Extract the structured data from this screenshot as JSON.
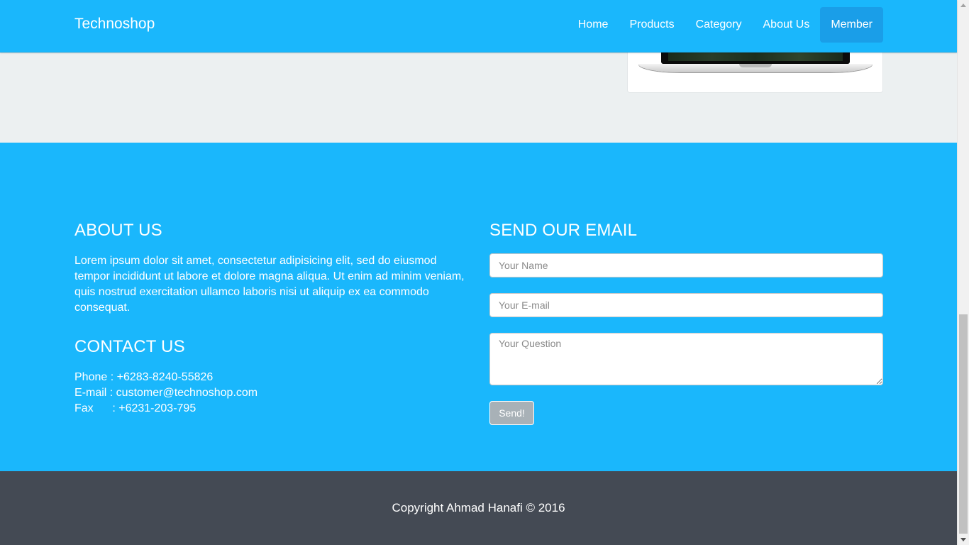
{
  "navbar": {
    "brand": "Technoshop",
    "items": [
      {
        "label": "Home"
      },
      {
        "label": "Products"
      },
      {
        "label": "Category"
      },
      {
        "label": "About Us"
      },
      {
        "label": "Member",
        "active": true
      }
    ],
    "color": "#1ab7fc"
  },
  "footer": {
    "about": {
      "title": "ABOUT US",
      "text": "Lorem ipsum dolor sit amet, consectetur adipisicing elit, sed do eiusmod tempor incididunt ut labore et dolore magna aliqua. Ut enim ad minim veniam, quis nostrud exercitation ullamco laboris nisi ut aliquip ex ea commodo consequat."
    },
    "contact": {
      "title": "CONTACT US",
      "phone": "Phone : +6283-8240-55826",
      "email": "E-mail : customer@technoshop.com",
      "fax": "Fax      : +6231-203-795"
    },
    "email_form": {
      "title": "SEND OUR EMAIL",
      "name_placeholder": "Your Name",
      "email_placeholder": "Your E-mail",
      "question_placeholder": "Your Question",
      "send_label": "Send!"
    }
  },
  "copyright": {
    "text": "Copyright Ahmad Hanafi © 2016",
    "color": "#444a54"
  },
  "icons": {
    "product_image": "laptop-image"
  }
}
